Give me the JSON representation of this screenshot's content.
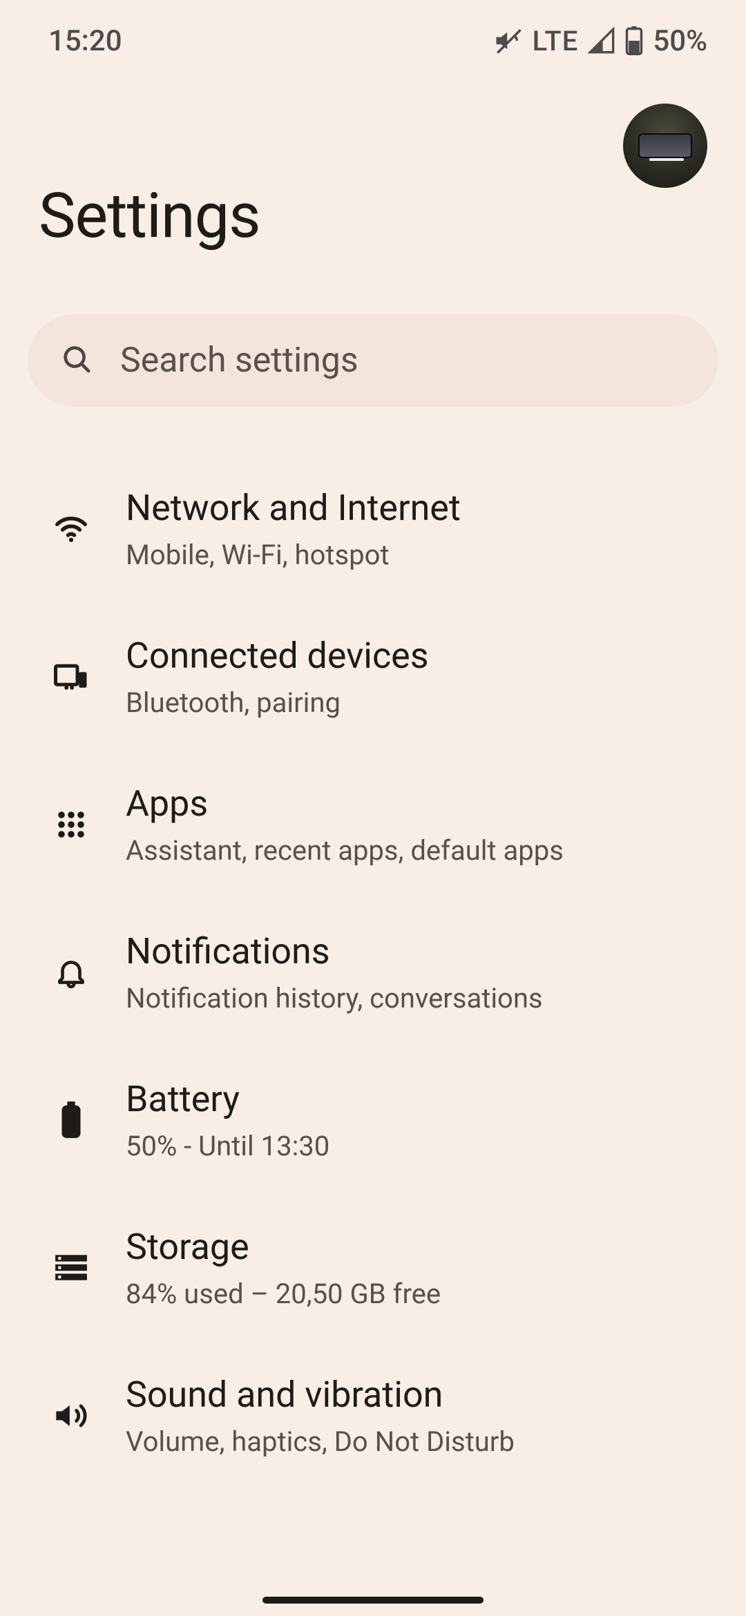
{
  "status": {
    "time": "15:20",
    "network_label": "LTE",
    "battery_text": "50%"
  },
  "header": {
    "title": "Settings"
  },
  "search": {
    "placeholder": "Search settings"
  },
  "items": [
    {
      "icon": "wifi-icon",
      "title": "Network and Internet",
      "sub": "Mobile, Wi-Fi, hotspot"
    },
    {
      "icon": "devices-icon",
      "title": "Connected devices",
      "sub": "Bluetooth, pairing"
    },
    {
      "icon": "apps-icon",
      "title": "Apps",
      "sub": "Assistant, recent apps, default apps"
    },
    {
      "icon": "bell-icon",
      "title": "Notifications",
      "sub": "Notification history, conversations"
    },
    {
      "icon": "battery-icon",
      "title": "Battery",
      "sub": "50% - Until 13:30"
    },
    {
      "icon": "storage-icon",
      "title": "Storage",
      "sub": "84% used – 20,50 GB free"
    },
    {
      "icon": "volume-icon",
      "title": "Sound and vibration",
      "sub": "Volume, haptics, Do Not Disturb"
    }
  ]
}
